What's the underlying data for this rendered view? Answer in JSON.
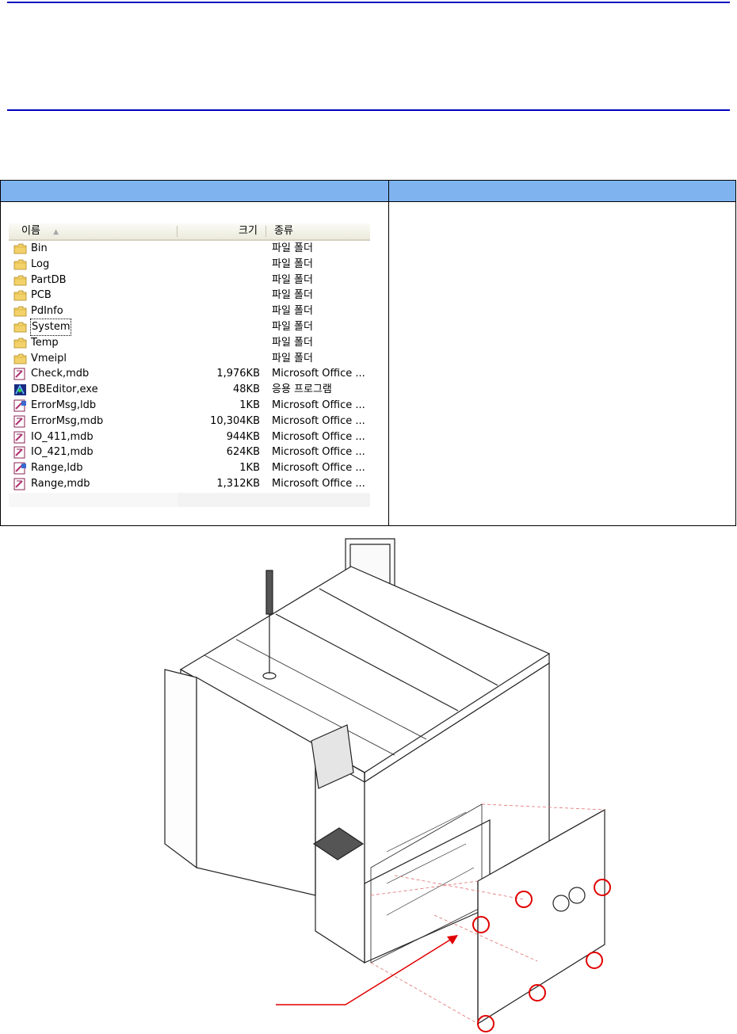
{
  "explorer": {
    "columns": {
      "name": "이름",
      "size": "크기",
      "type": "종류"
    },
    "sort_indicator": "▲",
    "rows": [
      {
        "name": "Bin",
        "size": "",
        "type": "파일 폴더",
        "icon": "folder-icon"
      },
      {
        "name": "Log",
        "size": "",
        "type": "파일 폴더",
        "icon": "folder-icon"
      },
      {
        "name": "PartDB",
        "size": "",
        "type": "파일 폴더",
        "icon": "folder-icon"
      },
      {
        "name": "PCB",
        "size": "",
        "type": "파일 폴더",
        "icon": "folder-icon"
      },
      {
        "name": "PdInfo",
        "size": "",
        "type": "파일 폴더",
        "icon": "folder-icon"
      },
      {
        "name": "System",
        "size": "",
        "type": "파일 폴더",
        "icon": "folder-icon"
      },
      {
        "name": "Temp",
        "size": "",
        "type": "파일 폴더",
        "icon": "folder-icon"
      },
      {
        "name": "Vmeipl",
        "size": "",
        "type": "파일 폴더",
        "icon": "folder-icon"
      },
      {
        "name": "Check,mdb",
        "size": "1,976KB",
        "type": "Microsoft Office ...",
        "icon": "access-db-icon"
      },
      {
        "name": "DBEditor,exe",
        "size": "48KB",
        "type": "응용 프로그램",
        "icon": "application-icon"
      },
      {
        "name": "ErrorMsg,ldb",
        "size": "1KB",
        "type": "Microsoft Office ...",
        "icon": "access-lock-icon"
      },
      {
        "name": "ErrorMsg,mdb",
        "size": "10,304KB",
        "type": "Microsoft Office ...",
        "icon": "access-db-icon"
      },
      {
        "name": "IO_411,mdb",
        "size": "944KB",
        "type": "Microsoft Office ...",
        "icon": "access-db-icon"
      },
      {
        "name": "IO_421,mdb",
        "size": "624KB",
        "type": "Microsoft Office ...",
        "icon": "access-db-icon"
      },
      {
        "name": "Range,ldb",
        "size": "1KB",
        "type": "Microsoft Office ...",
        "icon": "access-lock-icon"
      },
      {
        "name": "Range,mdb",
        "size": "1,312KB",
        "type": "Microsoft Office ...",
        "icon": "access-db-icon"
      }
    ],
    "focused_row": "System"
  },
  "colors": {
    "rule": "#0000c0",
    "table_header": "#7fb3f0",
    "folder": "#f3d26b",
    "highlight_circle": "#e00000"
  }
}
